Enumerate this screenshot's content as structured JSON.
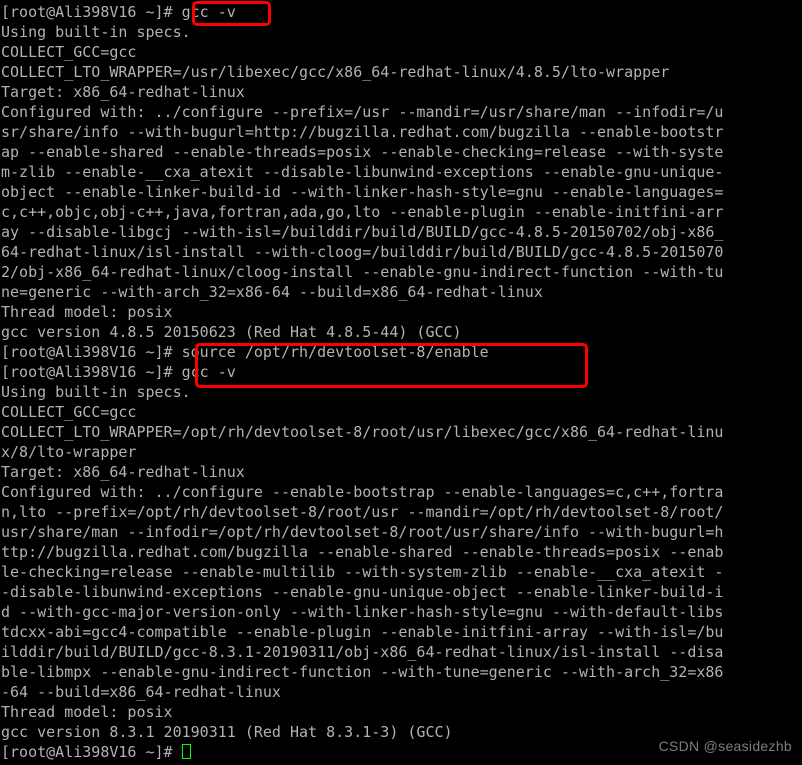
{
  "terminal": {
    "prompt": "[root@Ali398V16 ~]# ",
    "foreground_color": "#b2b2b2",
    "background_color": "#000000",
    "cursor_color": "#00ff00",
    "highlight_color": "#fe0000",
    "lines": [
      {
        "type": "prompt",
        "prompt": "[root@Ali398V16 ~]# ",
        "text": "gcc -v"
      },
      {
        "type": "output",
        "text": "Using built-in specs."
      },
      {
        "type": "output",
        "text": "COLLECT_GCC=gcc"
      },
      {
        "type": "output",
        "text": "COLLECT_LTO_WRAPPER=/usr/libexec/gcc/x86_64-redhat-linux/4.8.5/lto-wrapper"
      },
      {
        "type": "output",
        "text": "Target: x86_64-redhat-linux"
      },
      {
        "type": "output",
        "text": "Configured with: ../configure --prefix=/usr --mandir=/usr/share/man --infodir=/u"
      },
      {
        "type": "output",
        "text": "sr/share/info --with-bugurl=http://bugzilla.redhat.com/bugzilla --enable-bootstr"
      },
      {
        "type": "output",
        "text": "ap --enable-shared --enable-threads=posix --enable-checking=release --with-syste"
      },
      {
        "type": "output",
        "text": "m-zlib --enable-__cxa_atexit --disable-libunwind-exceptions --enable-gnu-unique-"
      },
      {
        "type": "output",
        "text": "object --enable-linker-build-id --with-linker-hash-style=gnu --enable-languages="
      },
      {
        "type": "output",
        "text": "c,c++,objc,obj-c++,java,fortran,ada,go,lto --enable-plugin --enable-initfini-arr"
      },
      {
        "type": "output",
        "text": "ay --disable-libgcj --with-isl=/builddir/build/BUILD/gcc-4.8.5-20150702/obj-x86_"
      },
      {
        "type": "output",
        "text": "64-redhat-linux/isl-install --with-cloog=/builddir/build/BUILD/gcc-4.8.5-2015070"
      },
      {
        "type": "output",
        "text": "2/obj-x86_64-redhat-linux/cloog-install --enable-gnu-indirect-function --with-tu"
      },
      {
        "type": "output",
        "text": "ne=generic --with-arch_32=x86-64 --build=x86_64-redhat-linux"
      },
      {
        "type": "output",
        "text": "Thread model: posix"
      },
      {
        "type": "output",
        "text": "gcc version 4.8.5 20150623 (Red Hat 4.8.5-44) (GCC)"
      },
      {
        "type": "prompt",
        "prompt": "[root@Ali398V16 ~]# ",
        "text": "source /opt/rh/devtoolset-8/enable"
      },
      {
        "type": "prompt",
        "prompt": "[root@Ali398V16 ~]# ",
        "text": "gcc -v"
      },
      {
        "type": "output",
        "text": "Using built-in specs."
      },
      {
        "type": "output",
        "text": "COLLECT_GCC=gcc"
      },
      {
        "type": "output",
        "text": "COLLECT_LTO_WRAPPER=/opt/rh/devtoolset-8/root/usr/libexec/gcc/x86_64-redhat-linu"
      },
      {
        "type": "output",
        "text": "x/8/lto-wrapper"
      },
      {
        "type": "output",
        "text": "Target: x86_64-redhat-linux"
      },
      {
        "type": "output",
        "text": "Configured with: ../configure --enable-bootstrap --enable-languages=c,c++,fortra"
      },
      {
        "type": "output",
        "text": "n,lto --prefix=/opt/rh/devtoolset-8/root/usr --mandir=/opt/rh/devtoolset-8/root/"
      },
      {
        "type": "output",
        "text": "usr/share/man --infodir=/opt/rh/devtoolset-8/root/usr/share/info --with-bugurl=h"
      },
      {
        "type": "output",
        "text": "ttp://bugzilla.redhat.com/bugzilla --enable-shared --enable-threads=posix --enab"
      },
      {
        "type": "output",
        "text": "le-checking=release --enable-multilib --with-system-zlib --enable-__cxa_atexit -"
      },
      {
        "type": "output",
        "text": "-disable-libunwind-exceptions --enable-gnu-unique-object --enable-linker-build-i"
      },
      {
        "type": "output",
        "text": "d --with-gcc-major-version-only --with-linker-hash-style=gnu --with-default-libs"
      },
      {
        "type": "output",
        "text": "tdcxx-abi=gcc4-compatible --enable-plugin --enable-initfini-array --with-isl=/bu"
      },
      {
        "type": "output",
        "text": "ilddir/build/BUILD/gcc-8.3.1-20190311/obj-x86_64-redhat-linux/isl-install --disa"
      },
      {
        "type": "output",
        "text": "ble-libmpx --enable-gnu-indirect-function --with-tune=generic --with-arch_32=x86"
      },
      {
        "type": "output",
        "text": "-64 --build=x86_64-redhat-linux"
      },
      {
        "type": "output",
        "text": "Thread model: posix"
      },
      {
        "type": "output",
        "text": "gcc version 8.3.1 20190311 (Red Hat 8.3.1-3) (GCC)"
      },
      {
        "type": "cursor",
        "prompt": "[root@Ali398V16 ~]# ",
        "text": ""
      }
    ]
  },
  "highlights": {
    "first_command": "gcc -v",
    "second_command_block": "source /opt/rh/devtoolset-8/enable\ngcc -v"
  },
  "watermark": {
    "text": "CSDN @seasidezhb"
  }
}
